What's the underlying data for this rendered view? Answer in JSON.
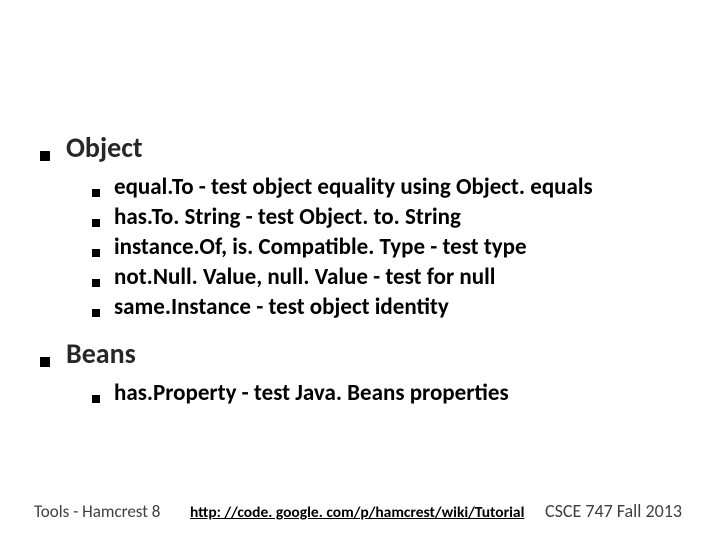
{
  "sections": [
    {
      "heading": "Object",
      "items": [
        "equal.To - test object equality using Object. equals",
        "has.To. String - test Object. to. String",
        "instance.Of, is. Compatible. Type - test type",
        "not.Null. Value, null. Value - test for null",
        "same.Instance - test object identity"
      ]
    },
    {
      "heading": "Beans",
      "items": [
        "has.Property - test Java. Beans properties"
      ]
    }
  ],
  "footer": {
    "left": "Tools - Hamcrest  8",
    "link": "http: //code. google. com/p/hamcrest/wiki/Tutorial",
    "right": "CSCE 747 Fall 2013"
  }
}
